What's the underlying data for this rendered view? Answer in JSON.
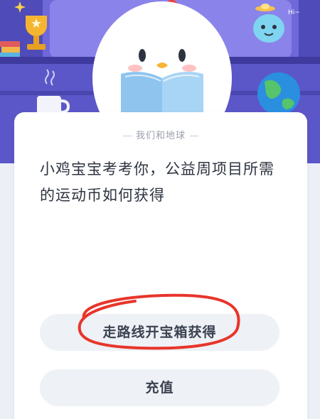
{
  "card": {
    "section_label": "我们和地球",
    "question": "小鸡宝宝考考你，公益周项目所需的运动币如何获得"
  },
  "options": [
    {
      "label": "走路线开宝箱获得"
    },
    {
      "label": "充值"
    }
  ],
  "scene": {
    "speech_text": "Hi~"
  },
  "colors": {
    "background_purple": "#5a55c9",
    "annotation_red": "#e8352b",
    "option_bg": "#eef1f6"
  }
}
